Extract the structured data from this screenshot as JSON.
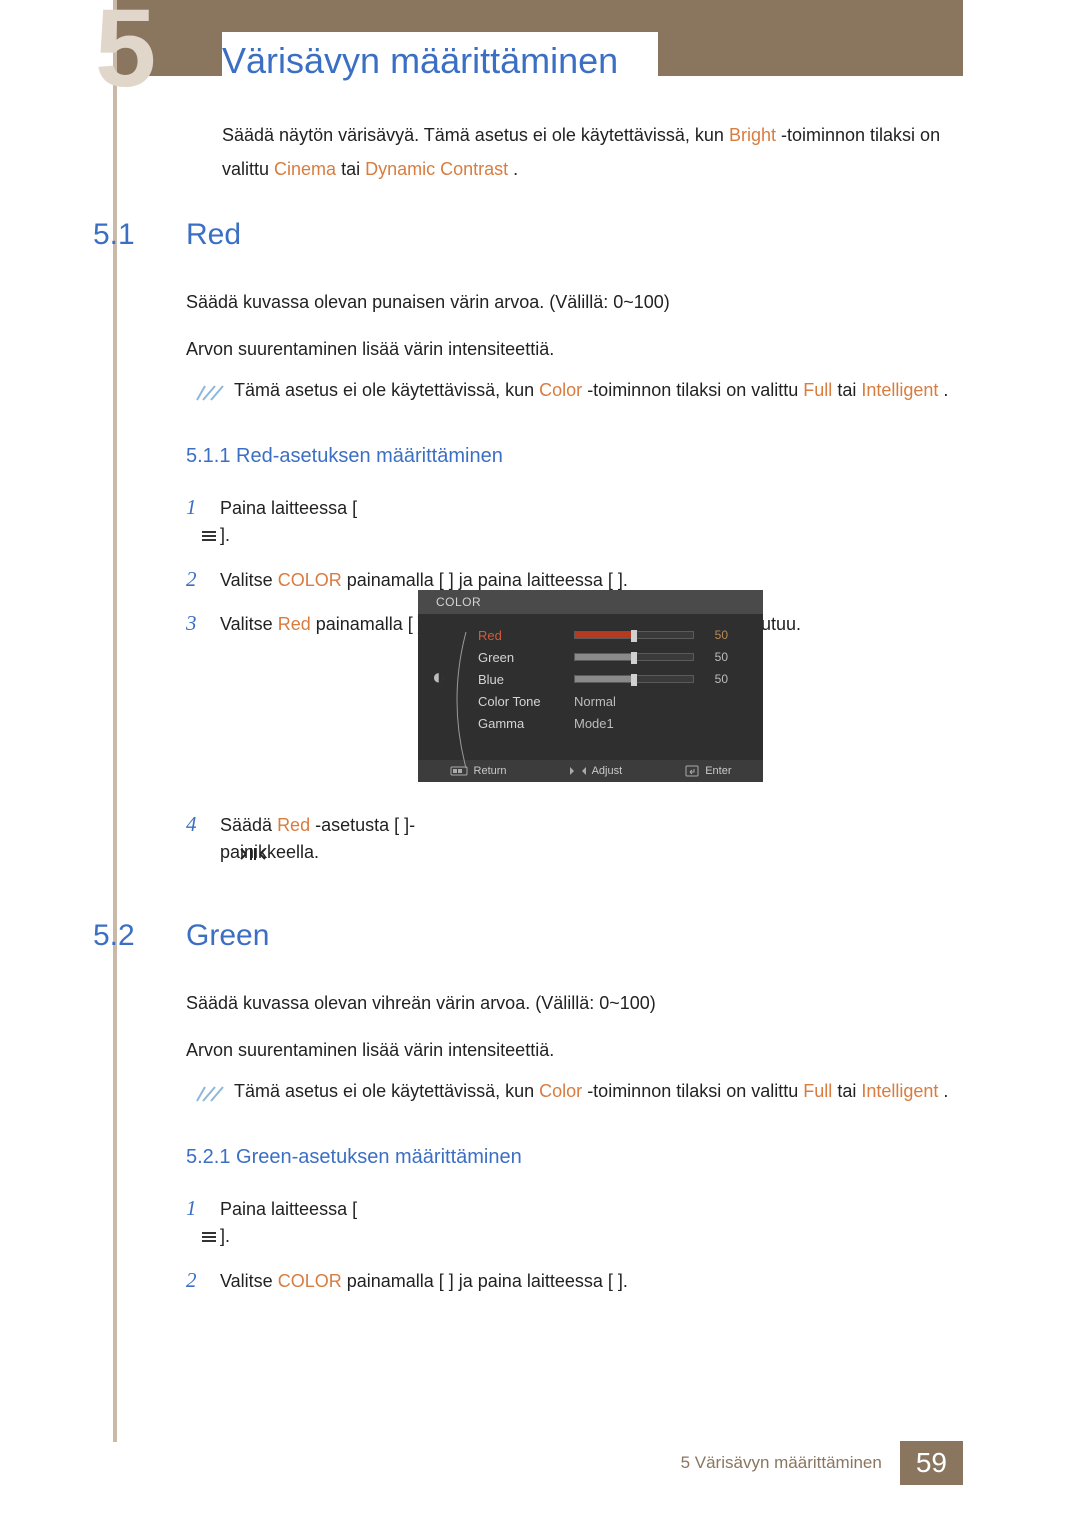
{
  "chapter": {
    "number_glyph": "5",
    "title": "Värisävyn määrittäminen",
    "intro_before_bright": "Säädä näytön värisävyä. Tämä asetus ei ole käytettävissä, kun ",
    "samsung_magic": "",
    "bright": "Bright",
    "intro_after_bright": "-toiminnon tilaksi on valittu ",
    "cinema": "Cinema",
    "intro_or": " tai ",
    "dynamic_contrast": "Dynamic Contrast",
    "intro_period": "."
  },
  "sec1": {
    "num": "5.1",
    "name": "Red",
    "p1": "Säädä kuvassa olevan punaisen värin arvoa. (Välillä: 0~100)",
    "p2": "Arvon suurentaminen lisää värin intensiteettiä.",
    "note_before": "Tämä asetus ei ole käytettävissä, kun ",
    "note_color": "Color",
    "note_after_color": "-toiminnon tilaksi on valittu ",
    "note_full": "Full",
    "note_or": " tai ",
    "note_intelligent": "Intelligent",
    "note_period": "."
  },
  "sub511": {
    "label": "5.1.1   Red-asetuksen määrittäminen",
    "i1": "Paina laitteessa [     ].",
    "i2a": "Valitse ",
    "i2_color": "COLOR",
    "i2b": " painamalla [      ] ja paina laitteessa [     ].",
    "i3a": "Valitse ",
    "i3_red": "Red",
    "i3b": " painamalla [      ] ja paina laitteessa [     ]. Oheinen ikkuna avautuu.",
    "i4a": "Säädä ",
    "i4_red": "Red",
    "i4b": " -asetusta [       ]-painikkeella."
  },
  "menu": {
    "title": "COLOR",
    "rows": [
      {
        "label": "Red",
        "value": "50",
        "fill": 50,
        "color": "#b53a20",
        "red": true
      },
      {
        "label": "Green",
        "value": "50",
        "fill": 50,
        "color": "#8a8a8a"
      },
      {
        "label": "Blue",
        "value": "50",
        "fill": 50,
        "color": "#8a8a8a"
      },
      {
        "label": "Color Tone",
        "text": "Normal"
      },
      {
        "label": "Gamma",
        "text": "Mode1"
      }
    ],
    "foot": {
      "return": "Return",
      "adjust": "Adjust",
      "enter": "Enter"
    }
  },
  "sec2": {
    "num": "5.2",
    "name": "Green",
    "p1": "Säädä kuvassa olevan vihreän värin arvoa. (Välillä: 0~100)",
    "p2": "Arvon suurentaminen lisää värin intensiteettiä.",
    "note_before": "Tämä asetus ei ole käytettävissä, kun ",
    "note_color": "Color",
    "note_after_color": "-toiminnon tilaksi on valittu ",
    "note_full": "Full",
    "note_or": " tai ",
    "note_intelligent": "Intelligent",
    "note_period": "."
  },
  "sub521": {
    "label": "5.2.1   Green-asetuksen määrittäminen",
    "i1": "Paina laitteessa [     ].",
    "i2a": "Valitse ",
    "i2_color": "COLOR",
    "i2b": " painamalla [      ] ja paina laitteessa [     ]."
  },
  "footer": {
    "text": "5 Värisävyn määrittäminen",
    "page": "59"
  },
  "nums": {
    "n1": "1",
    "n2": "2",
    "n3": "3",
    "n4": "4"
  }
}
